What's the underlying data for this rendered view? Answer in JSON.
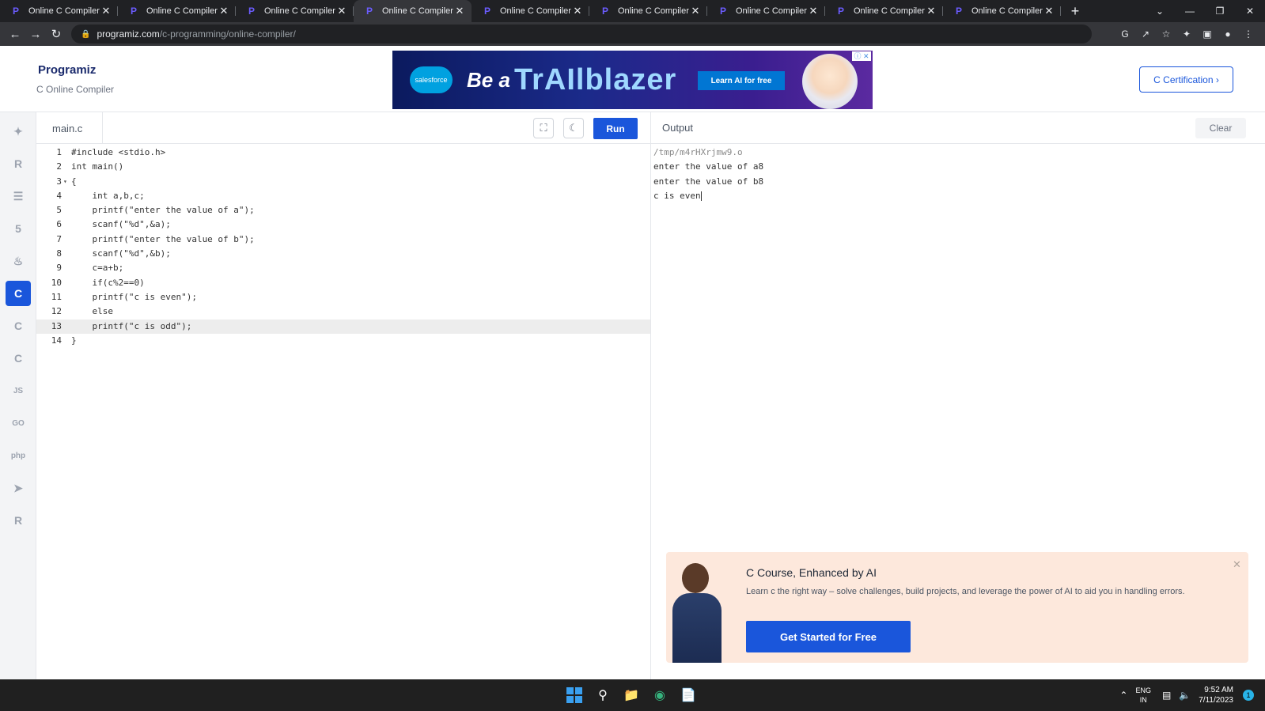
{
  "browser": {
    "tabs": [
      {
        "title": "Online C Compiler",
        "active": false
      },
      {
        "title": "Online C Compiler",
        "active": false
      },
      {
        "title": "Online C Compiler",
        "active": false
      },
      {
        "title": "Online C Compiler",
        "active": true
      },
      {
        "title": "Online C Compiler",
        "active": false
      },
      {
        "title": "Online C Compiler",
        "active": false
      },
      {
        "title": "Online C Compiler",
        "active": false
      },
      {
        "title": "Online C Compiler",
        "active": false
      },
      {
        "title": "Online C Compiler",
        "active": false
      }
    ],
    "url_host": "programiz.com",
    "url_path": "/c-programming/online-compiler/"
  },
  "header": {
    "logo": "Programiz",
    "subtitle": "C Online Compiler",
    "cert_button": "C Certification ›"
  },
  "ad": {
    "brand": "salesforce",
    "headline_a": "Be a",
    "headline_b": "TrAIlblazer",
    "cta": "Learn AI for free"
  },
  "sidebar": {
    "items": [
      {
        "icon": "python-icon",
        "glyph": "✦"
      },
      {
        "icon": "r-icon",
        "glyph": "R"
      },
      {
        "icon": "sql-icon",
        "glyph": "☰"
      },
      {
        "icon": "html-icon",
        "glyph": "5"
      },
      {
        "icon": "java-icon",
        "glyph": "♨"
      },
      {
        "icon": "c-icon",
        "glyph": "C",
        "active": true
      },
      {
        "icon": "cpp-icon",
        "glyph": "C"
      },
      {
        "icon": "csharp-icon",
        "glyph": "C"
      },
      {
        "icon": "javascript-icon",
        "glyph": "JS"
      },
      {
        "icon": "go-icon",
        "glyph": "GO"
      },
      {
        "icon": "php-icon",
        "glyph": "php"
      },
      {
        "icon": "swift-icon",
        "glyph": "➤"
      },
      {
        "icon": "rust-icon",
        "glyph": "R"
      }
    ]
  },
  "editor": {
    "filename": "main.c",
    "run_label": "Run",
    "current_line": 13,
    "lines": [
      {
        "n": "1",
        "text": "#include <stdio.h>"
      },
      {
        "n": "2",
        "text": "int main()"
      },
      {
        "n": "3",
        "text": "{",
        "fold": true
      },
      {
        "n": "4",
        "text": "    int a,b,c;"
      },
      {
        "n": "5",
        "text": "    printf(\"enter the value of a\");"
      },
      {
        "n": "6",
        "text": "    scanf(\"%d\",&a);"
      },
      {
        "n": "7",
        "text": "    printf(\"enter the value of b\");"
      },
      {
        "n": "8",
        "text": "    scanf(\"%d\",&b);"
      },
      {
        "n": "9",
        "text": "    c=a+b;"
      },
      {
        "n": "10",
        "text": "    if(c%2==0)"
      },
      {
        "n": "11",
        "text": "    printf(\"c is even\");"
      },
      {
        "n": "12",
        "text": "    else"
      },
      {
        "n": "13",
        "text": "    printf(\"c is odd\");"
      },
      {
        "n": "14",
        "text": "}"
      }
    ]
  },
  "output": {
    "title": "Output",
    "clear_label": "Clear",
    "lines": [
      "/tmp/m4rHXrjmw9.o",
      "enter the value of a8",
      "enter the value of b8",
      "c is even"
    ]
  },
  "promo": {
    "title": "C Course, Enhanced by AI",
    "text": "Learn c the right way – solve challenges, build projects, and leverage the power of AI to aid you in handling errors.",
    "button": "Get Started for Free"
  },
  "taskbar": {
    "lang_top": "ENG",
    "lang_bottom": "IN",
    "time": "9:52 AM",
    "date": "7/11/2023",
    "notifications": "1"
  },
  "colors": {
    "accent": "#1a56db",
    "promo_bg": "#fde8dc",
    "tab_strip": "#202124"
  }
}
